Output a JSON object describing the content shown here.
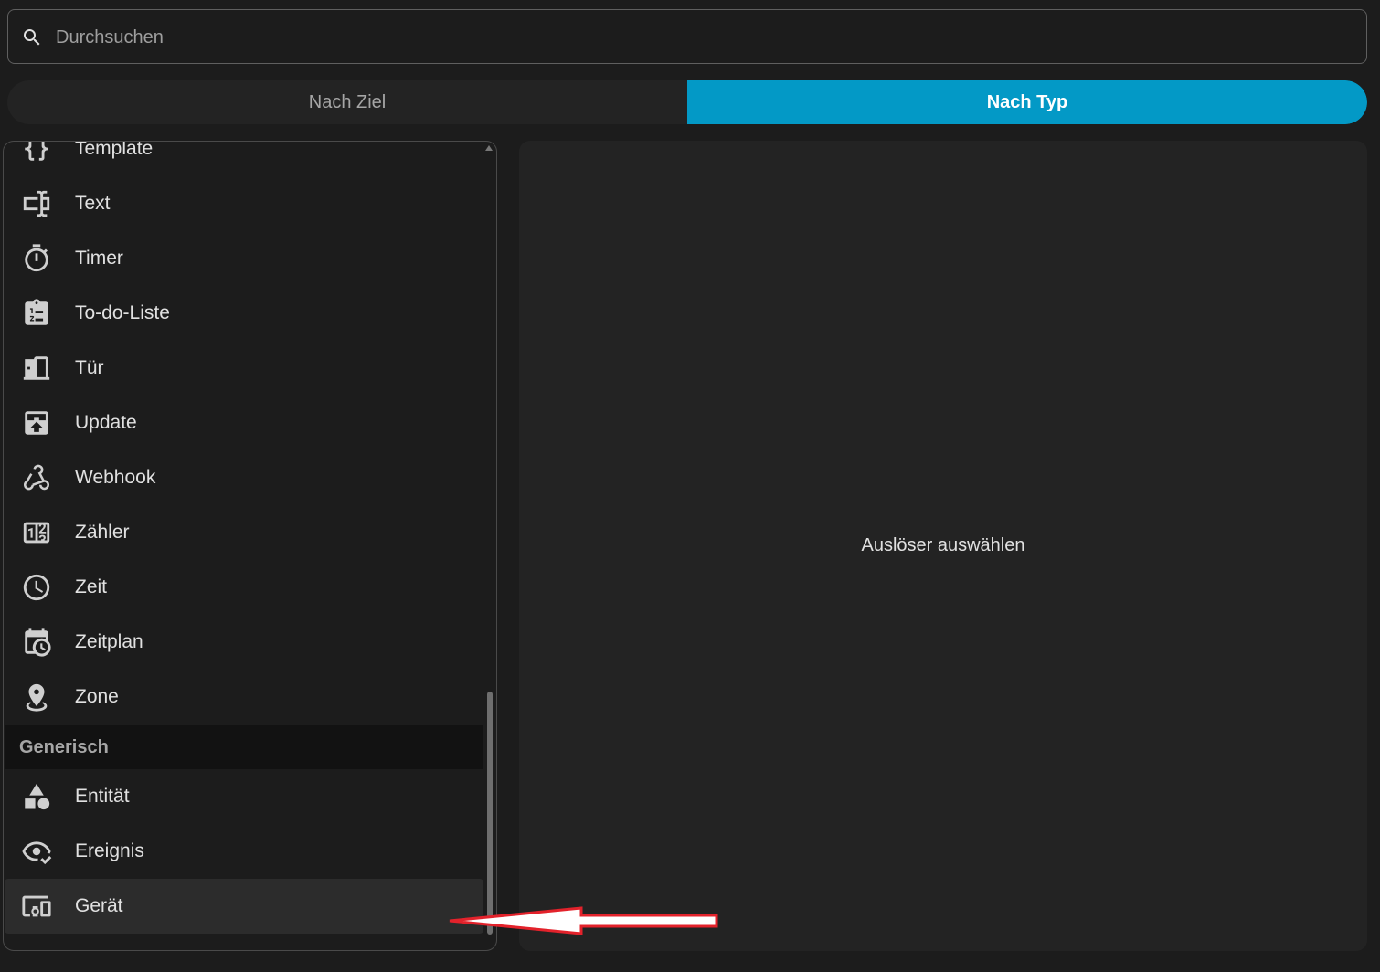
{
  "search": {
    "placeholder": "Durchsuchen",
    "value": ""
  },
  "toggle": {
    "by_target": "Nach Ziel",
    "by_type": "Nach Typ",
    "selected": "Nach Typ"
  },
  "list": {
    "items": [
      {
        "label": "Template",
        "icon": "code-braces-icon"
      },
      {
        "label": "Text",
        "icon": "form-textbox-icon"
      },
      {
        "label": "Timer",
        "icon": "timer-outline-icon"
      },
      {
        "label": "To-do-Liste",
        "icon": "clipboard-list-icon"
      },
      {
        "label": "Tür",
        "icon": "door-open-icon"
      },
      {
        "label": "Update",
        "icon": "package-up-icon"
      },
      {
        "label": "Webhook",
        "icon": "webhook-icon"
      },
      {
        "label": "Zähler",
        "icon": "counter-icon"
      },
      {
        "label": "Zeit",
        "icon": "clock-outline-icon"
      },
      {
        "label": "Zeitplan",
        "icon": "calendar-clock-icon"
      },
      {
        "label": "Zone",
        "icon": "map-marker-radius-icon"
      }
    ],
    "section_header": "Generisch",
    "generic_items": [
      {
        "label": "Entität",
        "icon": "shape-icon"
      },
      {
        "label": "Ereignis",
        "icon": "eye-check-icon"
      },
      {
        "label": "Gerät",
        "icon": "devices-icon",
        "selected": true
      }
    ]
  },
  "detail": {
    "text": "Auslöser auswählen"
  },
  "colors": {
    "accent": "#0399c6",
    "annotation_arrow": "#e3222b",
    "background": "#1c1c1c"
  }
}
